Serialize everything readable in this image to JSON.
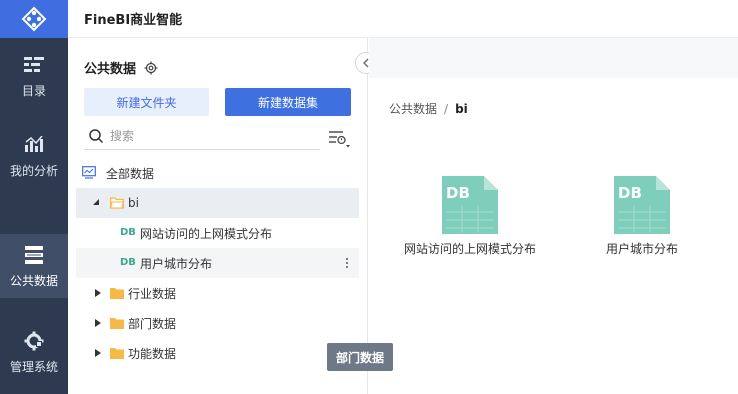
{
  "app": {
    "title": "FineBI商业智能"
  },
  "nav": {
    "items": [
      {
        "label": "目录",
        "icon": "catalog-icon"
      },
      {
        "label": "我的分析",
        "icon": "analysis-chart-icon"
      },
      {
        "label": "公共数据",
        "icon": "public-data-icon",
        "active": true
      },
      {
        "label": "管理系统",
        "icon": "gear-admin-icon"
      }
    ]
  },
  "panel": {
    "title": "公共数据",
    "new_folder_label": "新建文件夹",
    "new_dataset_label": "新建数据集",
    "search_placeholder": "搜索",
    "tree": {
      "root": "全部数据",
      "folder_bi": "bi",
      "dataset_1_tag": "DB",
      "dataset_1": "网站访问的上网模式分布",
      "dataset_2_tag": "DB",
      "dataset_2": "用户城市分布",
      "folder_industry": "行业数据",
      "folder_department": "部门数据",
      "folder_function": "功能数据"
    }
  },
  "main": {
    "breadcrumb": {
      "root": "公共数据",
      "separator": "/",
      "current": "bi"
    },
    "cards": [
      {
        "label": "网站访问的上网模式分布",
        "tag": "DB"
      },
      {
        "label": "用户城市分布",
        "tag": "DB"
      }
    ]
  },
  "tooltip": {
    "text": "部门数据"
  },
  "colors": {
    "accent": "#3e70e0",
    "rail_bg": "#2d3a4f",
    "doc_icon": "#7fcdbb",
    "folder": "#f5b948"
  }
}
